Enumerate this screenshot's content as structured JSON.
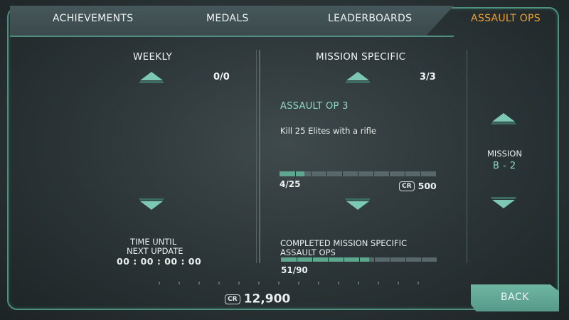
{
  "tabs": [
    {
      "label": "ACHIEVEMENTS",
      "active": false
    },
    {
      "label": "MEDALS",
      "active": false
    },
    {
      "label": "LEADERBOARDS",
      "active": false
    },
    {
      "label": "ASSAULT OPS",
      "active": true
    }
  ],
  "weekly": {
    "header": "WEEKLY",
    "count": "0/0",
    "timer_label_1": "TIME UNTIL",
    "timer_label_2": "NEXT UPDATE",
    "timer_value": "00 : 00 : 00 : 00"
  },
  "mission_specific": {
    "header": "MISSION SPECIFIC",
    "count": "3/3",
    "op_title": "ASSAULT OP 3",
    "op_desc": "Kill 25 Elites with a rifle",
    "progress_text": "4/25",
    "progress_fraction": 0.16,
    "cr_label": "CR",
    "reward": "500",
    "completed_label_1": "COMPLETED MISSION SPECIFIC",
    "completed_label_2": "ASSAULT OPS",
    "completed_text": "51/90",
    "completed_fraction": 0.567
  },
  "mission": {
    "label": "MISSION",
    "value": "B - 2"
  },
  "credits": {
    "cr_label": "CR",
    "value": "12,900"
  },
  "back_label": "BACK",
  "colors": {
    "accent": "#5fa68f",
    "active_tab": "#e8a33a",
    "teal_text": "#8fd8c4"
  }
}
